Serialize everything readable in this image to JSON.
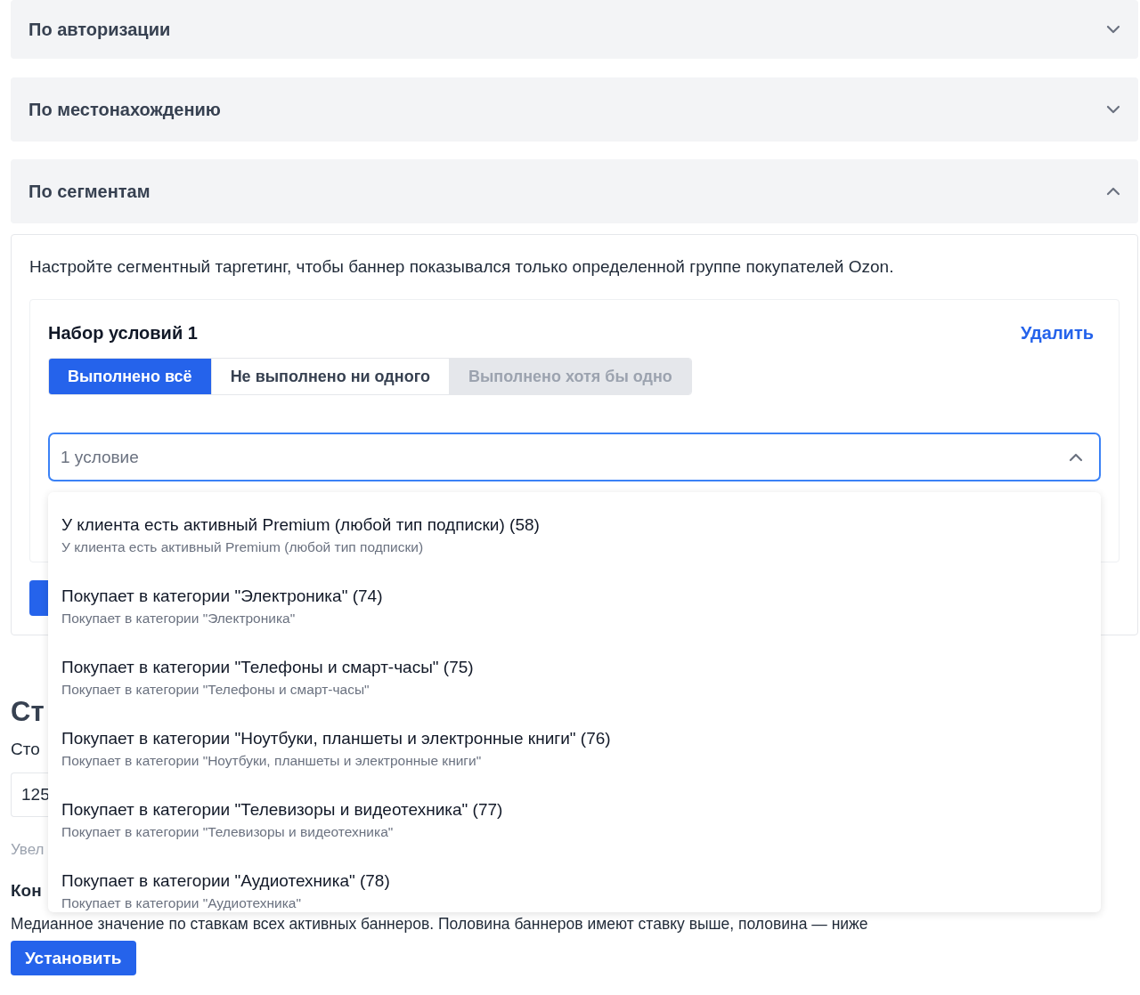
{
  "accordions": [
    {
      "title": "По авторизации",
      "expanded": false
    },
    {
      "title": "По местонахождению",
      "expanded": false
    },
    {
      "title": "По сегментам",
      "expanded": true
    }
  ],
  "segments": {
    "description": "Настройте сегментный таргетинг, чтобы баннер показывался только определенной группе покупателей Ozon.",
    "condition_set": {
      "title": "Набор условий 1",
      "delete_link": "Удалить",
      "modes": [
        {
          "label": "Выполнено всё",
          "selected": true,
          "disabled": false
        },
        {
          "label": "Не выполнено ни одного",
          "selected": false,
          "disabled": false
        },
        {
          "label": "Выполнено хотя бы одно",
          "selected": false,
          "disabled": true
        }
      ],
      "select": {
        "placeholder": "1 условие",
        "expanded": true,
        "options": [
          {
            "title": "У клиента есть активный Premium (любой тип подписки) (58)",
            "subtitle": "У клиента есть активный Premium (любой тип подписки)"
          },
          {
            "title": "Покупает в категории \"Электроника\" (74)",
            "subtitle": "Покупает в категории \"Электроника\""
          },
          {
            "title": "Покупает в категории \"Телефоны и смарт-часы\" (75)",
            "subtitle": "Покупает в категории \"Телефоны и смарт-часы\""
          },
          {
            "title": "Покупает в категории \"Ноутбуки, планшеты и электронные книги\" (76)",
            "subtitle": "Покупает в категории \"Ноутбуки, планшеты и электронные книги\""
          },
          {
            "title": "Покупает в категории \"Телевизоры и видеотехника\" (77)",
            "subtitle": "Покупает в категории \"Телевизоры и видеотехника\""
          },
          {
            "title": "Покупает в категории \"Аудиотехника\" (78)",
            "subtitle": "Покупает в категории \"Аудиотехника\""
          }
        ]
      }
    }
  },
  "rate": {
    "heading": "Ст",
    "label": "Сто",
    "input_value": "125",
    "hint": "Увел",
    "subheading": "Кон",
    "description": "Медианное значение по ставкам всех активных баннеров. Половина баннеров имеют ставку выше, половина — ниже",
    "button": "Установить"
  }
}
